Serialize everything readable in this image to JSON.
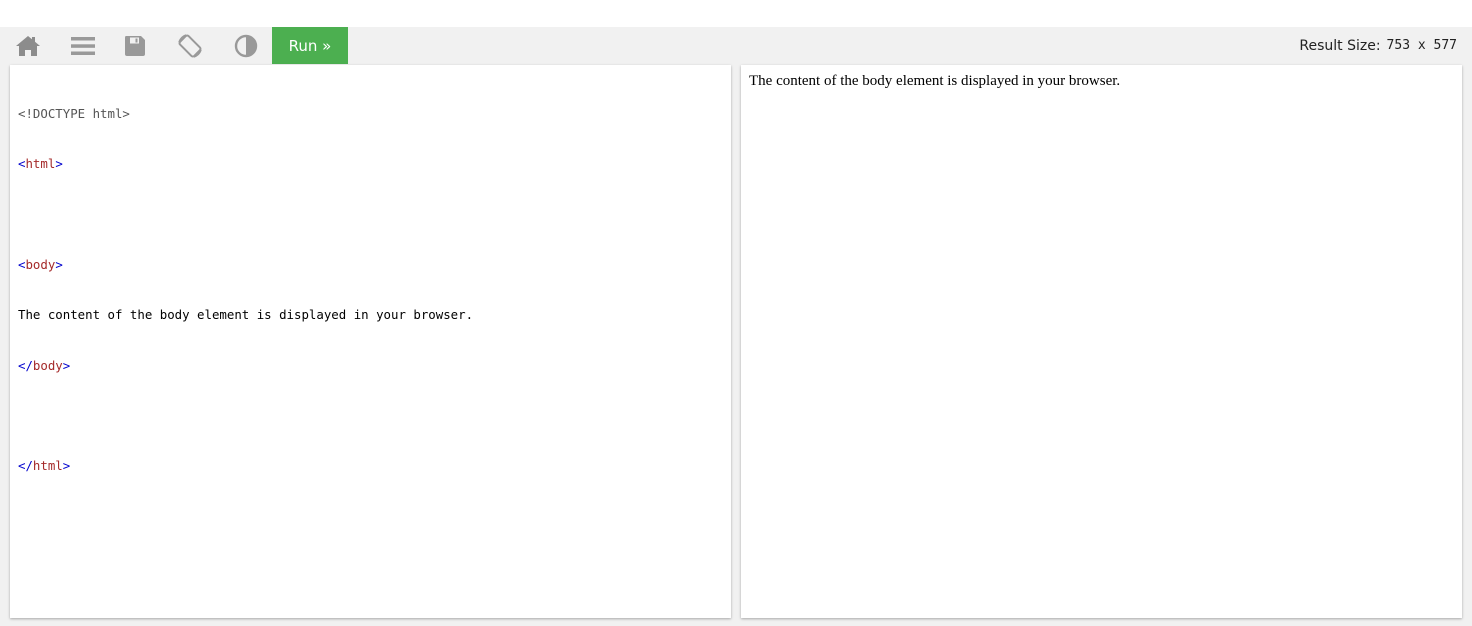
{
  "toolbar": {
    "icons": [
      {
        "name": "home-icon",
        "label": "Home"
      },
      {
        "name": "menu-icon",
        "label": "Menu"
      },
      {
        "name": "save-icon",
        "label": "Save"
      },
      {
        "name": "rotate-icon",
        "label": "Change orientation"
      },
      {
        "name": "contrast-icon",
        "label": "Change theme"
      }
    ],
    "run_label": "Run »",
    "icon_color": "#999999",
    "run_color": "#4caf50"
  },
  "result_size": {
    "label": "Result Size:",
    "value": "753 x 577"
  },
  "editor": {
    "lines": [
      {
        "doctype": "<!DOCTYPE html>"
      },
      {
        "open": "<",
        "tag": "html",
        "close": ">"
      },
      {},
      {
        "open": "<",
        "tag": "body",
        "close": ">"
      },
      {
        "text": "The content of the body element is displayed in your browser."
      },
      {
        "open": "</",
        "tag": "body",
        "close": ">"
      },
      {},
      {
        "open": "</",
        "tag": "html",
        "close": ">"
      }
    ]
  },
  "result": {
    "text": "The content of the body element is displayed in your browser."
  }
}
